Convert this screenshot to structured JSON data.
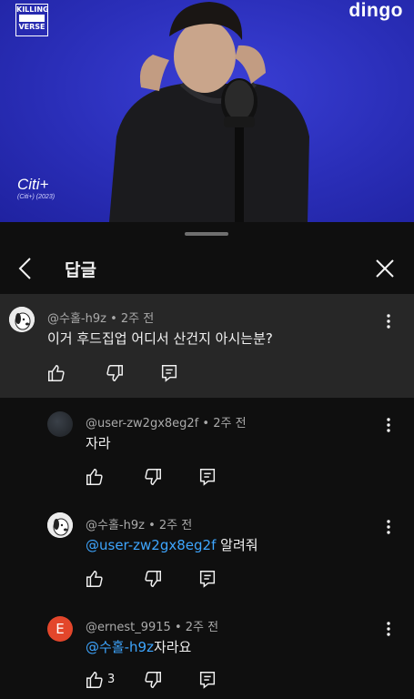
{
  "video": {
    "badge_line1": "KILLING",
    "badge_line2": "VERSE",
    "brand": "dingo",
    "song": "Citi+",
    "song_sub": "(Citi+) (2023)"
  },
  "header": {
    "title": "답글"
  },
  "parent": {
    "author": "@수홀-h9z",
    "time": "2주 전",
    "text": "이거 후드집업 어디서 산건지 아시는분?"
  },
  "replies": [
    {
      "author": "@user-zw2gx8eg2f",
      "time": "2주 전",
      "mention": "",
      "text": "자라",
      "likes": ""
    },
    {
      "author": "@수홀-h9z",
      "time": "2주 전",
      "mention": "@user-zw2gx8eg2f",
      "text": " 알려줘",
      "likes": ""
    },
    {
      "author": "@ernest_9915",
      "time": "2주 전",
      "mention": "@수홀-h9z",
      "text": "자라요",
      "likes": "3",
      "avatar_letter": "E"
    }
  ],
  "separator": "•",
  "colors": {
    "accent_link": "#3ea6ff",
    "video_bg": "#2b2fc0",
    "avatar_e": "#e3462b"
  }
}
